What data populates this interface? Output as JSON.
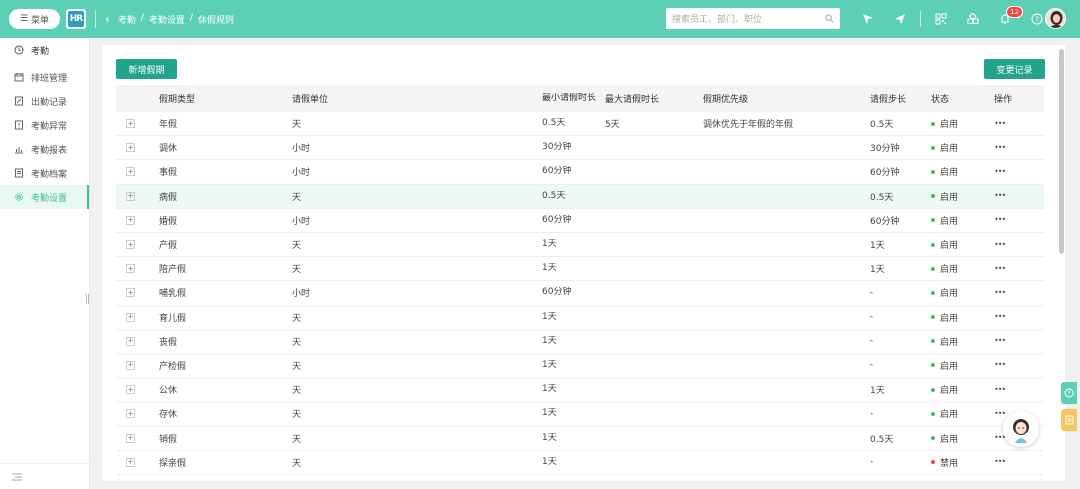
{
  "topbar": {
    "menu_label": "菜单",
    "logo_text": "HR",
    "breadcrumb": [
      "考勤",
      "考勤设置",
      "休假规则"
    ],
    "breadcrumb_sep": "/",
    "search_placeholder": "搜索员工、部门、职位",
    "notification_count": "12",
    "accent": "#5ccfb4"
  },
  "sidebar": {
    "items": [
      {
        "label": "考勤",
        "icon": "clock-icon"
      },
      {
        "label": "排班管理",
        "icon": "calendar-icon"
      },
      {
        "label": "出勤记录",
        "icon": "edit-doc-icon"
      },
      {
        "label": "考勤异常",
        "icon": "alert-doc-icon"
      },
      {
        "label": "考勤报表",
        "icon": "chart-icon"
      },
      {
        "label": "考勤档案",
        "icon": "file-icon"
      },
      {
        "label": "考勤设置",
        "icon": "gear-icon"
      }
    ],
    "active_index": 6
  },
  "toolbar": {
    "add_label": "新增假期",
    "history_label": "变更记录"
  },
  "table": {
    "headers": [
      "假期类型",
      "请假单位",
      "最小请假时长",
      "最大请假时长",
      "假期优先级",
      "请假步长",
      "状态",
      "操作"
    ],
    "rows": [
      {
        "type": "年假",
        "unit": "天",
        "min": "0.5天",
        "max": "5天",
        "priority": "调休优先于年假的年假",
        "step": "0.5天",
        "status": "启用",
        "status_color": "#36c05b"
      },
      {
        "type": "调休",
        "unit": "小时",
        "min": "30分钟",
        "max": "",
        "priority": "",
        "step": "30分钟",
        "status": "启用",
        "status_color": "#36c05b"
      },
      {
        "type": "事假",
        "unit": "小时",
        "min": "60分钟",
        "max": "",
        "priority": "",
        "step": "60分钟",
        "status": "启用",
        "status_color": "#36c05b"
      },
      {
        "type": "病假",
        "unit": "天",
        "min": "0.5天",
        "max": "",
        "priority": "",
        "step": "0.5天",
        "status": "启用",
        "status_color": "#36c05b"
      },
      {
        "type": "婚假",
        "unit": "小时",
        "min": "60分钟",
        "max": "",
        "priority": "",
        "step": "60分钟",
        "status": "启用",
        "status_color": "#36c05b"
      },
      {
        "type": "产假",
        "unit": "天",
        "min": "1天",
        "max": "",
        "priority": "",
        "step": "1天",
        "status": "启用",
        "status_color": "#36c05b"
      },
      {
        "type": "陪产假",
        "unit": "天",
        "min": "1天",
        "max": "",
        "priority": "",
        "step": "1天",
        "status": "启用",
        "status_color": "#36c05b"
      },
      {
        "type": "哺乳假",
        "unit": "小时",
        "min": "60分钟",
        "max": "",
        "priority": "",
        "step": "-",
        "status": "启用",
        "status_color": "#36c05b"
      },
      {
        "type": "育儿假",
        "unit": "天",
        "min": "1天",
        "max": "",
        "priority": "",
        "step": "-",
        "status": "启用",
        "status_color": "#36c05b"
      },
      {
        "type": "丧假",
        "unit": "天",
        "min": "1天",
        "max": "",
        "priority": "",
        "step": "-",
        "status": "启用",
        "status_color": "#36c05b"
      },
      {
        "type": "产检假",
        "unit": "天",
        "min": "1天",
        "max": "",
        "priority": "",
        "step": "-",
        "status": "启用",
        "status_color": "#36c05b"
      },
      {
        "type": "公休",
        "unit": "天",
        "min": "1天",
        "max": "",
        "priority": "",
        "step": "1天",
        "status": "启用",
        "status_color": "#36c05b"
      },
      {
        "type": "存休",
        "unit": "天",
        "min": "1天",
        "max": "",
        "priority": "",
        "step": "-",
        "status": "启用",
        "status_color": "#36c05b"
      },
      {
        "type": "销假",
        "unit": "天",
        "min": "1天",
        "max": "",
        "priority": "",
        "step": "0.5天",
        "status": "启用",
        "status_color": "#36c05b"
      },
      {
        "type": "探亲假",
        "unit": "天",
        "min": "1天",
        "max": "",
        "priority": "",
        "step": "-",
        "status": "禁用",
        "status_color": "#f0434c"
      }
    ],
    "highlight_index": 3,
    "ops_glyph": "•••"
  }
}
